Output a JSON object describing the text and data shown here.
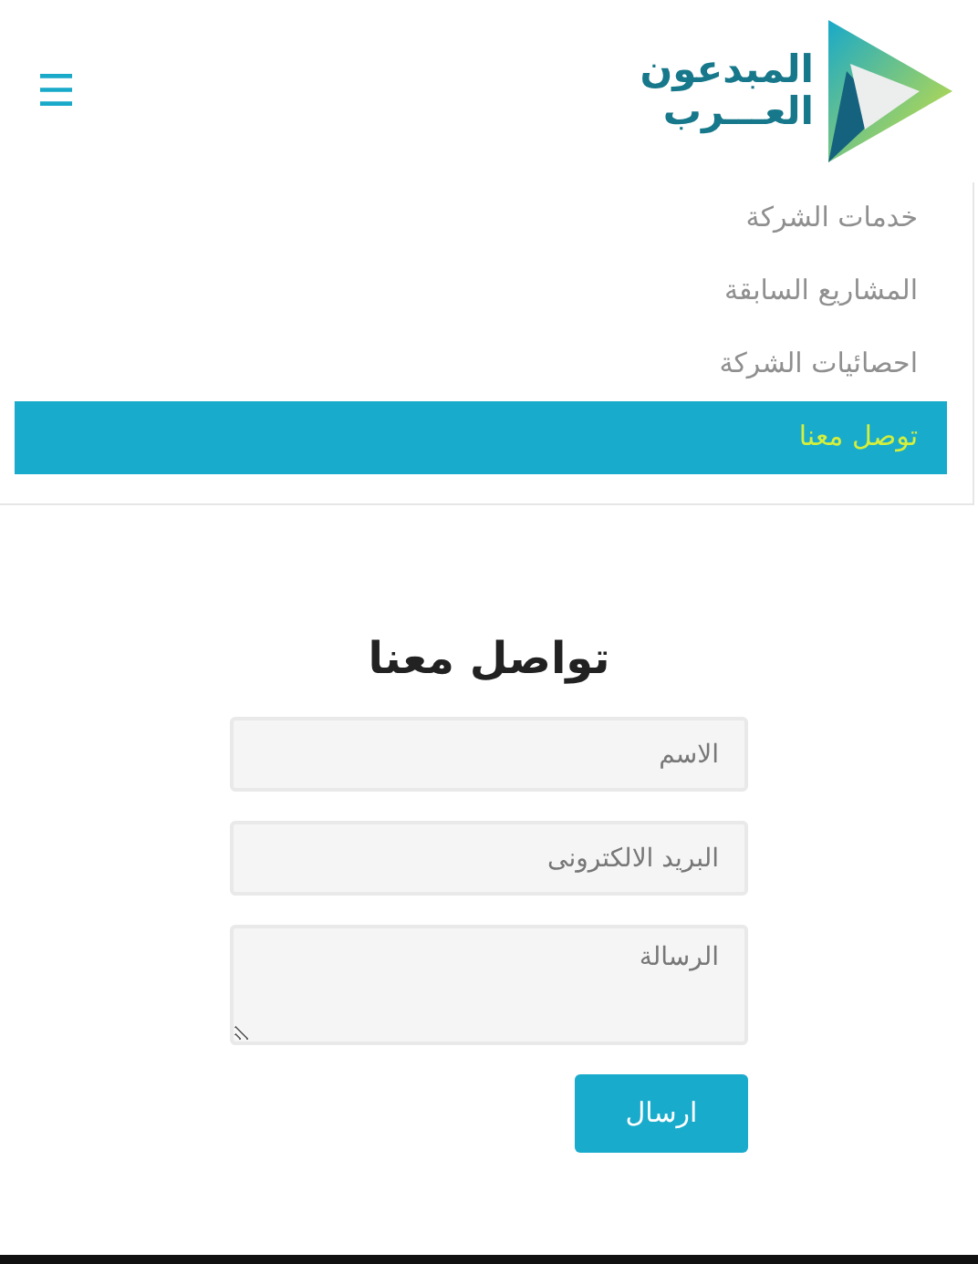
{
  "logo": {
    "line_1": "المبدعون",
    "line_2": "العـــرب"
  },
  "menu_button": {
    "icon": "☰"
  },
  "nav": [
    {
      "label": "خدمات الشركة",
      "selected": false
    },
    {
      "label": "المشاريع السابقة",
      "selected": false
    },
    {
      "label": "احصائيات الشركة",
      "selected": false
    },
    {
      "label": "توصل معنا",
      "selected": true
    }
  ],
  "contact_form": {
    "title": "تواصل معنا",
    "fields": [
      {
        "kind": "input",
        "placeholder": "الاسم"
      },
      {
        "kind": "input",
        "placeholder": "البريد الالكترونى"
      },
      {
        "kind": "textarea",
        "placeholder": "الرسالة"
      }
    ],
    "submit": "ارسال"
  }
}
